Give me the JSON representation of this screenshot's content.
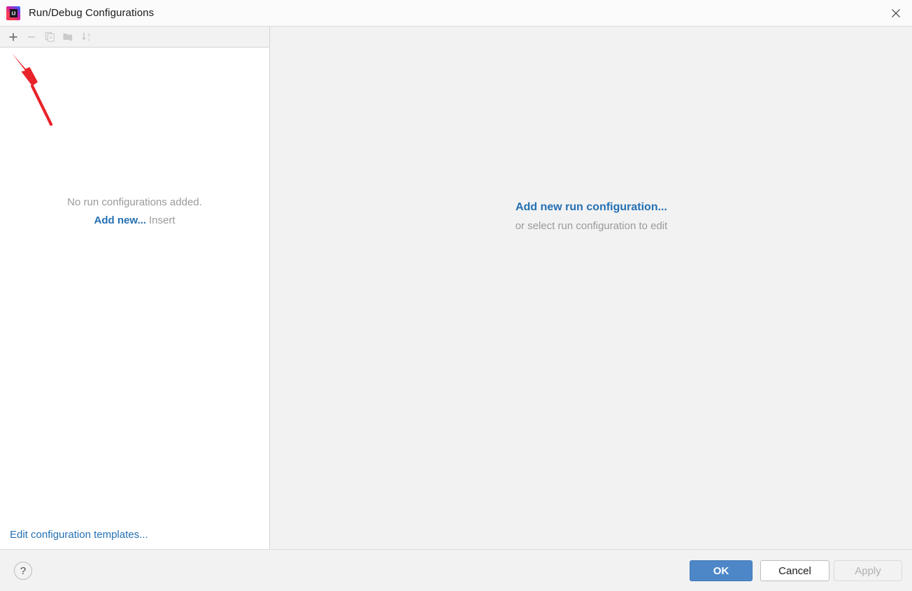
{
  "window": {
    "title": "Run/Debug Configurations",
    "app_icon": "intellij-idea-icon",
    "close_label": "✕"
  },
  "toolbar": {
    "buttons": [
      {
        "name": "add-configuration-button",
        "icon": "plus-icon",
        "enabled": true,
        "tooltip": "Add New Configuration"
      },
      {
        "name": "remove-configuration-button",
        "icon": "minus-icon",
        "enabled": false,
        "tooltip": "Remove Configuration"
      },
      {
        "name": "copy-configuration-button",
        "icon": "copy-icon",
        "enabled": false,
        "tooltip": "Copy Configuration"
      },
      {
        "name": "new-folder-button",
        "icon": "folder-plus-icon",
        "enabled": false,
        "tooltip": "Create New Folder"
      },
      {
        "name": "sort-configurations-button",
        "icon": "sort-alphabetically-icon",
        "enabled": false,
        "tooltip": "Sort Configurations"
      }
    ]
  },
  "left_panel": {
    "empty_message": "No run configurations added.",
    "add_new_link": "Add new...",
    "insert_shortcut": "Insert",
    "edit_templates_link": "Edit configuration templates..."
  },
  "right_panel": {
    "add_new_run_configuration": "Add new run configuration...",
    "or_select_hint": "or select run configuration to edit"
  },
  "footer": {
    "help_label": "?",
    "ok_label": "OK",
    "cancel_label": "Cancel",
    "apply_label": "Apply",
    "apply_enabled": false
  },
  "annotation": {
    "arrow": "red-arrow-pointing-to-add-button",
    "color": "#e8232a"
  },
  "colors": {
    "link_blue": "#2470b3",
    "primary_button": "#4d87c7",
    "muted_text": "#9a9a9a",
    "panel_background": "#f2f2f2",
    "list_background": "#ffffff",
    "annotation_red": "#e8232a"
  }
}
